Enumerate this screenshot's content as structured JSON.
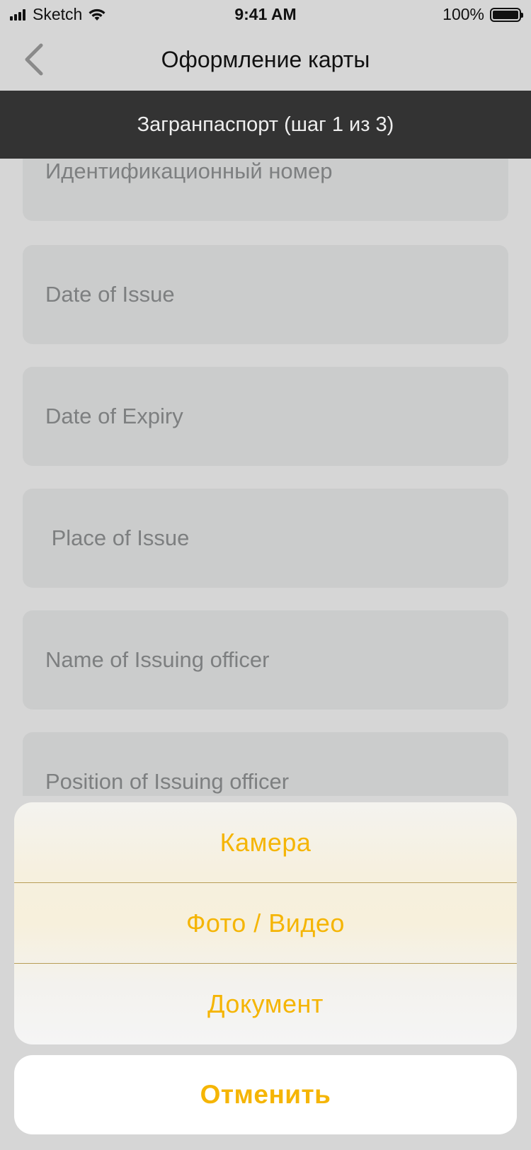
{
  "status_bar": {
    "carrier": "Sketch",
    "time": "9:41 AM",
    "battery": "100%"
  },
  "nav": {
    "title": "Оформление карты",
    "back_icon": "chevron-left-icon"
  },
  "step_banner": {
    "text": "Загранпаспорт (шаг 1 из 3)"
  },
  "form": {
    "fields": [
      {
        "placeholder": "Идентификационный номер"
      },
      {
        "placeholder": "Date of Issue"
      },
      {
        "placeholder": "Date of Expiry"
      },
      {
        "placeholder": " Place of Issue"
      },
      {
        "placeholder": "Name of Issuing officer"
      },
      {
        "placeholder": "Position of Issuing officer"
      }
    ]
  },
  "action_sheet": {
    "options": [
      {
        "label": "Камера"
      },
      {
        "label": "Фото / Видео"
      },
      {
        "label": "Документ"
      }
    ],
    "cancel_label": "Отменить"
  },
  "colors": {
    "accent": "#f5b505",
    "banner_bg": "#333333",
    "field_bg": "#cbcccc"
  }
}
